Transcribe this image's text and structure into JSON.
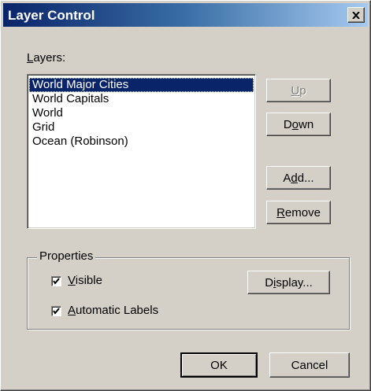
{
  "window": {
    "title": "Layer Control"
  },
  "layers": {
    "label": "Layers:",
    "items": [
      {
        "label": "World Major Cities",
        "selected": true
      },
      {
        "label": "World Capitals",
        "selected": false
      },
      {
        "label": "World",
        "selected": false
      },
      {
        "label": "Grid",
        "selected": false
      },
      {
        "label": "Ocean (Robinson)",
        "selected": false
      }
    ]
  },
  "buttons": {
    "up": "Up",
    "down": "Down",
    "add": "Add...",
    "remove": "Remove",
    "display": "Display...",
    "ok": "OK",
    "cancel": "Cancel"
  },
  "properties": {
    "legend": "Properties",
    "visible_label": "Visible",
    "visible_checked": true,
    "auto_labels_label": "Automatic Labels",
    "auto_labels_checked": true
  },
  "colors": {
    "title_bar": "#0a246a",
    "face": "#d4d0c8",
    "selection": "#0a246a"
  }
}
